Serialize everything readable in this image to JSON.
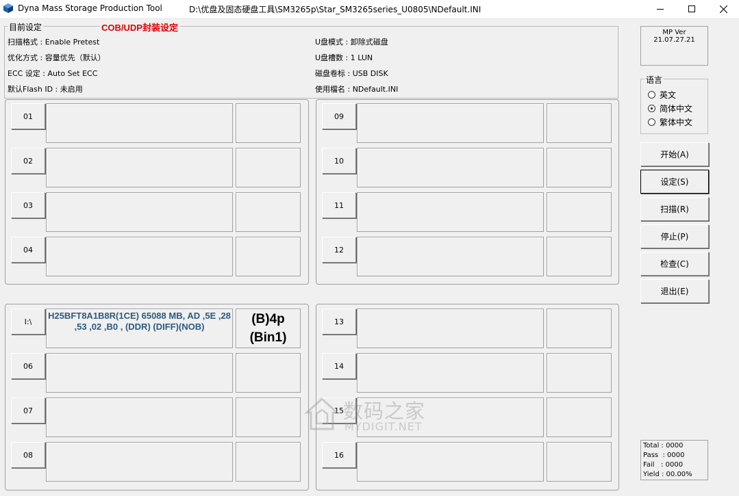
{
  "window": {
    "title": "Dyna Mass Storage Production Tool",
    "path": "D:\\优盘及固态硬盘工具\\SM3265p\\Star_SM3265series_U0805\\NDefault.INI"
  },
  "settings": {
    "group_label": "目前设定",
    "cob_label": "COB/UDP封装设定",
    "scan_format": "扫描格式 : Enable Pretest",
    "optimize": "优化方式 : 容量优先（默认）",
    "ecc": "ECC 设定 : Auto Set ECC",
    "flash_id": "默认Flash ID : 未启用",
    "disk_mode": "U盘模式 : 卸除式磁盘",
    "lun_count": "U盘槽数 : 1 LUN",
    "volume_label": "磁盘卷标 : USB DISK",
    "ini_name": "使用檔名 : NDefault.INI"
  },
  "ports": [
    {
      "label": "01",
      "info": "",
      "status": ""
    },
    {
      "label": "02",
      "info": "",
      "status": ""
    },
    {
      "label": "03",
      "info": "",
      "status": ""
    },
    {
      "label": "04",
      "info": "",
      "status": ""
    },
    {
      "label": "I:\\",
      "info": "H25BFT8A1B8R(1CE) 65088 MB, AD ,5E ,28 ,53 ,02 ,B0 , (DDR) (DIFF)(NOB)",
      "status": "(B)4p (Bin1)"
    },
    {
      "label": "06",
      "info": "",
      "status": ""
    },
    {
      "label": "07",
      "info": "",
      "status": ""
    },
    {
      "label": "08",
      "info": "",
      "status": ""
    },
    {
      "label": "09",
      "info": "",
      "status": ""
    },
    {
      "label": "10",
      "info": "",
      "status": ""
    },
    {
      "label": "11",
      "info": "",
      "status": ""
    },
    {
      "label": "12",
      "info": "",
      "status": ""
    },
    {
      "label": "13",
      "info": "",
      "status": ""
    },
    {
      "label": "14",
      "info": "",
      "status": ""
    },
    {
      "label": "15",
      "info": "",
      "status": ""
    },
    {
      "label": "16",
      "info": "",
      "status": ""
    }
  ],
  "version": "MP Ver 21.07.27.21",
  "language": {
    "label": "语言",
    "options": [
      "英文",
      "简体中文",
      "繁体中文"
    ],
    "selected": "简体中文"
  },
  "actions": {
    "start": "开始(A)",
    "settings": "设定(S)",
    "scan": "扫描(R)",
    "stop": "停止(P)",
    "check": "检查(C)",
    "exit": "退出(E)"
  },
  "stats": {
    "total": "Total : 0000",
    "pass": "Pass  : 0000",
    "fail": "Fail   : 0000",
    "yield": "Yield : 00.00%"
  },
  "watermark": {
    "cn": "数码之家",
    "en": "MYDIGIT.NET"
  }
}
